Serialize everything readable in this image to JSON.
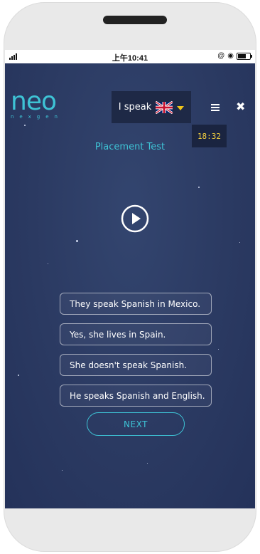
{
  "status_bar": {
    "time": "上午10:41",
    "status_icons": [
      "signal-icon",
      "alarm-icon",
      "clock-icon",
      "battery-icon"
    ]
  },
  "brand": {
    "name": "neo",
    "tagline": "nexgen"
  },
  "language": {
    "label": "I speak",
    "flag": "uk-flag-icon"
  },
  "timer": "18:32",
  "title": "Placement Test",
  "answers": [
    "They speak Spanish in Mexico.",
    "Yes, she lives in Spain.",
    "She doesn't speak Spanish.",
    "He speaks Spanish and English."
  ],
  "next_label": "NEXT",
  "colors": {
    "accent": "#3ec3d5",
    "background": "#2b3a62",
    "timer_text": "#f4d03f",
    "caret": "#f0c419"
  }
}
